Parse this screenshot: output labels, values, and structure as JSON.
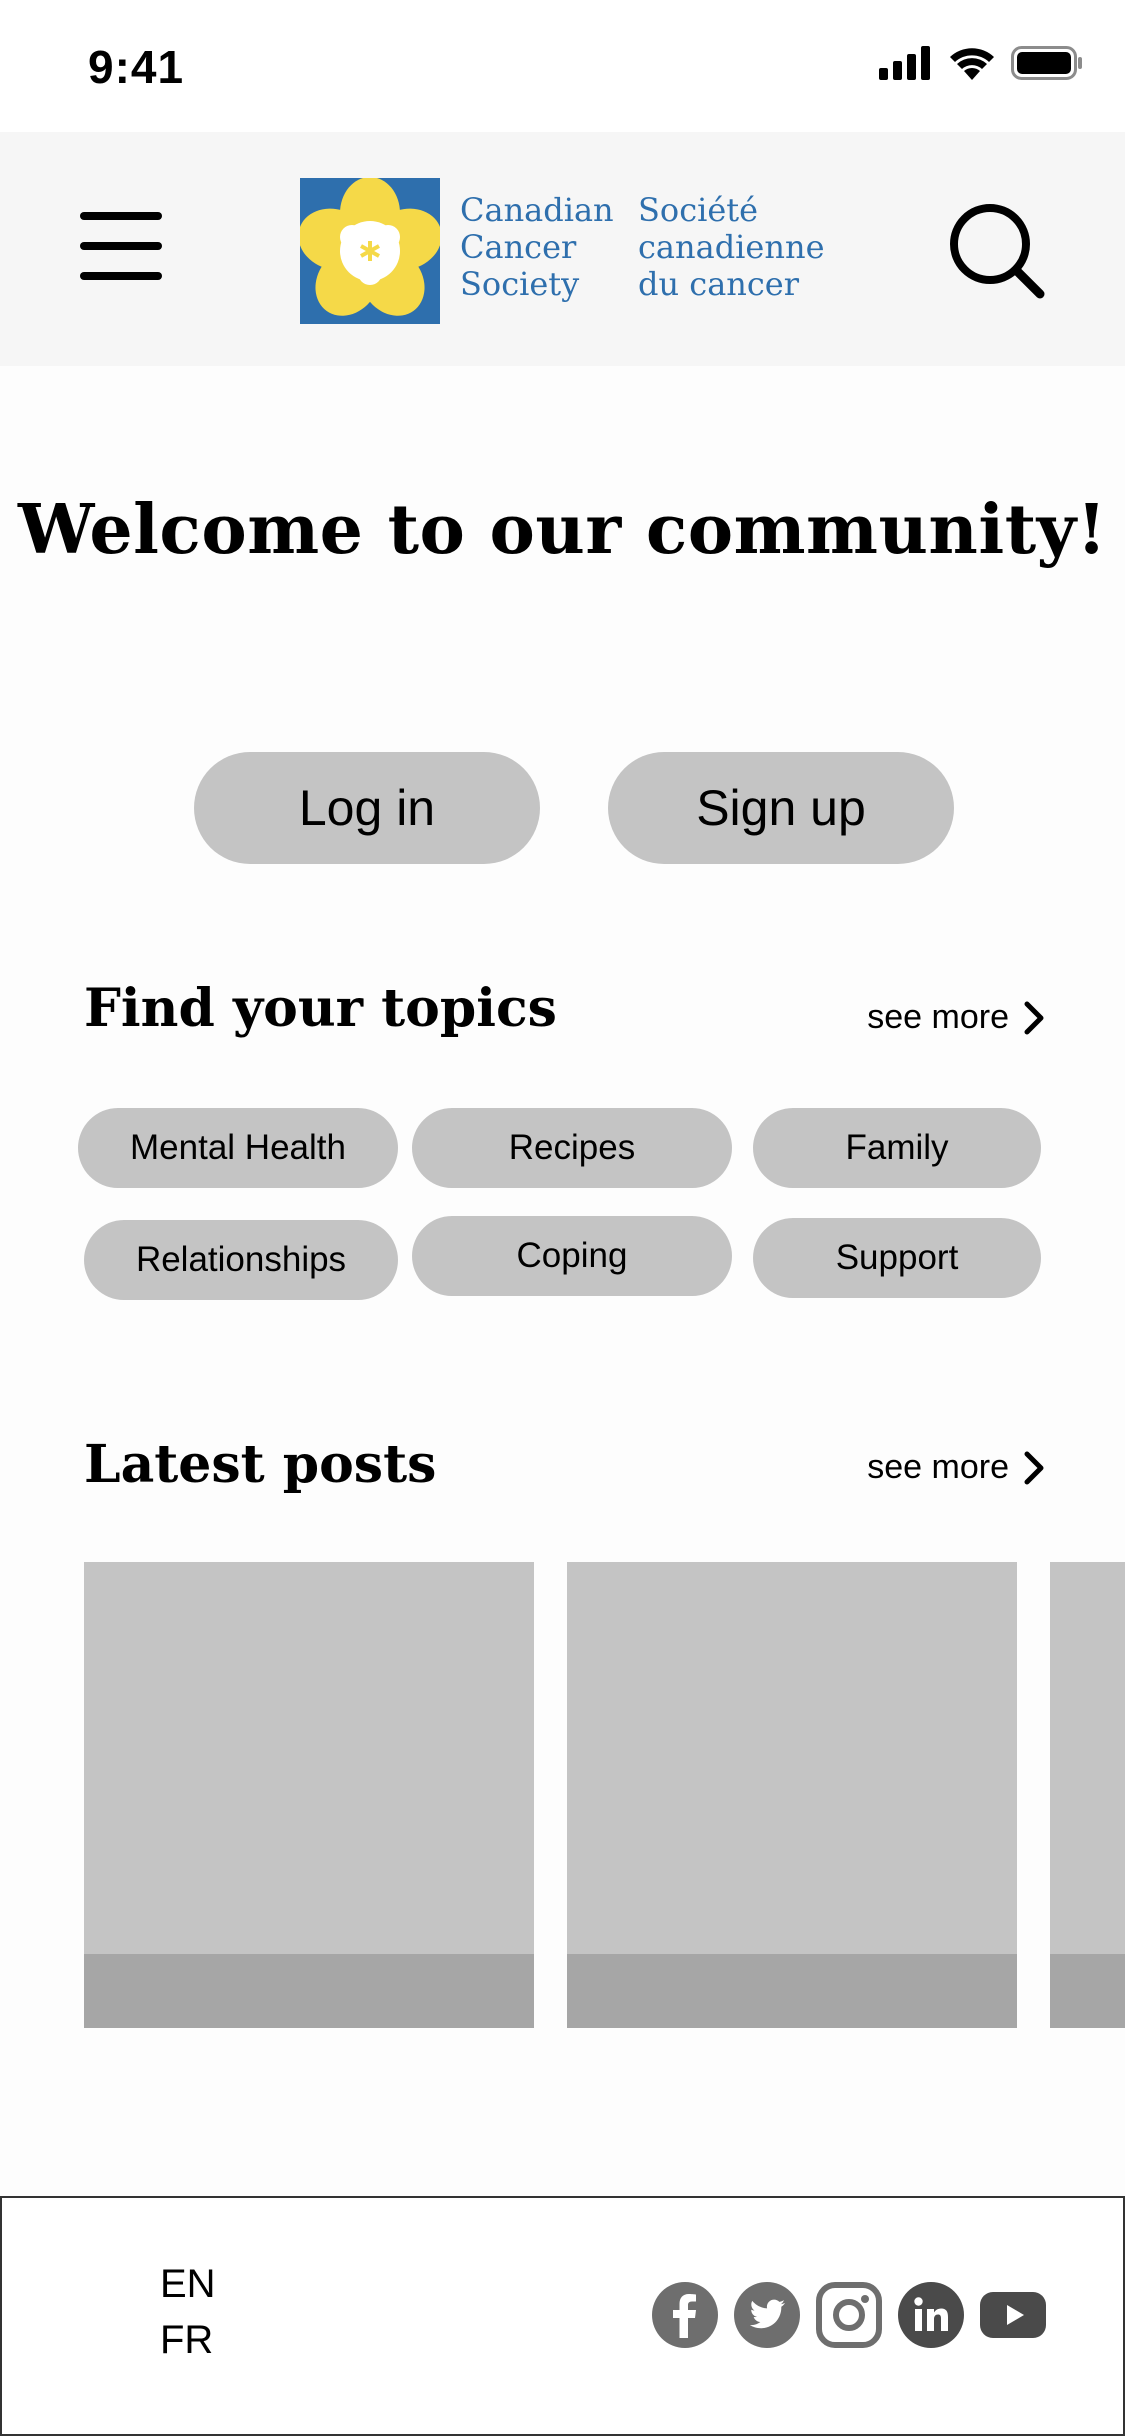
{
  "status_bar": {
    "time": "9:41",
    "icons": [
      "signal-icon",
      "wifi-icon",
      "battery-icon"
    ]
  },
  "header": {
    "menu_icon": "hamburger-menu-icon",
    "search_icon": "search-icon",
    "logo": {
      "en_lines": [
        "Canadian",
        "Cancer",
        "Society"
      ],
      "fr_lines": [
        "Société",
        "canadienne",
        "du cancer"
      ]
    }
  },
  "welcome": {
    "title": "Welcome to our community!"
  },
  "auth": {
    "login_label": "Log in",
    "signup_label": "Sign up"
  },
  "topics": {
    "title": "Find your topics",
    "see_more": "see more",
    "items": [
      "Mental Health",
      "Recipes",
      "Family",
      "Relationships",
      "Coping",
      "Support"
    ]
  },
  "posts": {
    "title": "Latest posts",
    "see_more": "see more"
  },
  "footer": {
    "languages": [
      "EN",
      "FR"
    ],
    "socials": [
      "facebook-icon",
      "twitter-icon",
      "instagram-icon",
      "linkedin-icon",
      "youtube-icon"
    ]
  },
  "colors": {
    "brand_blue": "#2e6fad",
    "brand_yellow": "#f5d948",
    "placeholder_gray": "#c4c4c4",
    "social_gray": "#6e6e6e"
  }
}
